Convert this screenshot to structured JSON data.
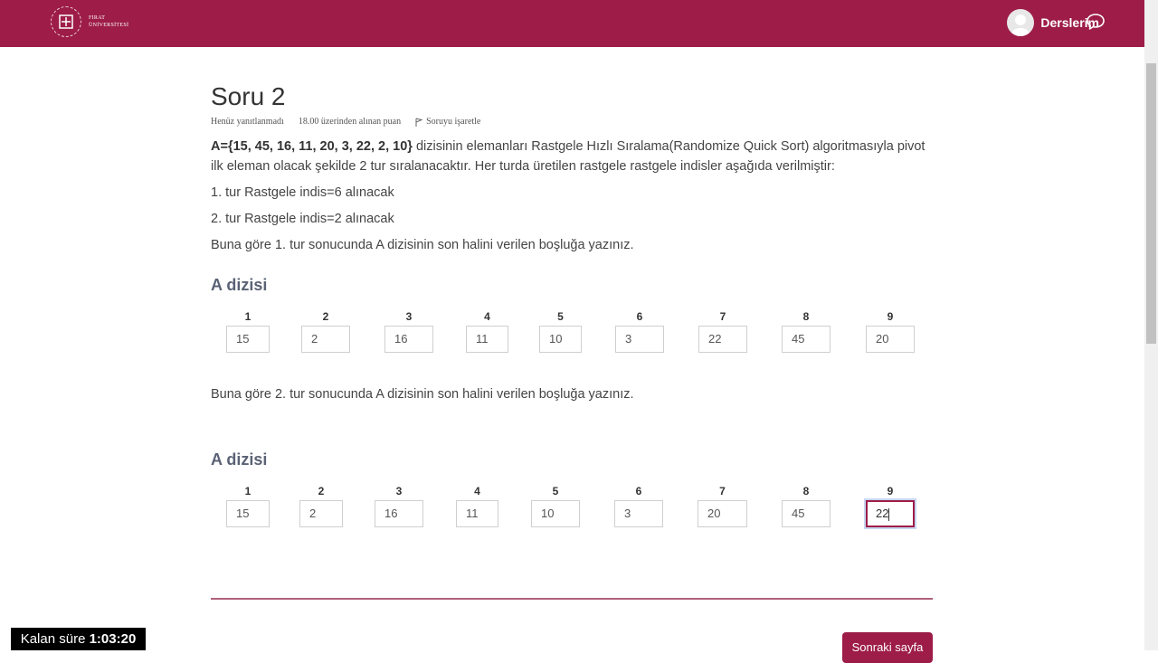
{
  "header": {
    "logo_line1": "FIRAT",
    "logo_line2": "ÜNİVERSİTESİ",
    "courses_link": "Derslerim",
    "brand_color": "#9d1c48"
  },
  "question": {
    "title": "Soru 2",
    "status": "Henüz yanıtlanmadı",
    "points": "18.00 üzerinden alınan puan",
    "flag_label": "Soruyu işaretle",
    "intro_bold": "A={15, 45, 16, 11, 20, 3, 22, 2, 10}",
    "intro_rest": " dizisinin elemanları Rastgele Hızlı Sıralama(Randomize Quick Sort) algoritmasıyla pivot ilk eleman olacak şekilde 2 tur sıralanacaktır. Her turda üretilen rastgele rastgele indisler aşağıda verilmiştir:",
    "round1_info": "1. tur Rastgele indis=6 alınacak",
    "round2_info": "2. tur Rastgele indis=2 alınacak",
    "prompt1": "Buna göre 1. tur sonucunda A dizisinin son halini verilen boşluğa yazınız.",
    "prompt2": "Buna göre 2. tur sonucunda A dizisinin son halini verilen boşluğa yazınız.",
    "array_title": "A dizisi"
  },
  "indices": [
    "1",
    "2",
    "3",
    "4",
    "5",
    "6",
    "7",
    "8",
    "9"
  ],
  "round1_values": [
    "15",
    "2",
    "16",
    "11",
    "10",
    "3",
    "22",
    "45",
    "20"
  ],
  "round2_values": [
    "15",
    "2",
    "16",
    "11",
    "10",
    "3",
    "20",
    "45",
    "22"
  ],
  "navigation": {
    "next_label": "Sonraki sayfa"
  },
  "timer": {
    "label": "Kalan süre",
    "value": "1:03:20"
  }
}
